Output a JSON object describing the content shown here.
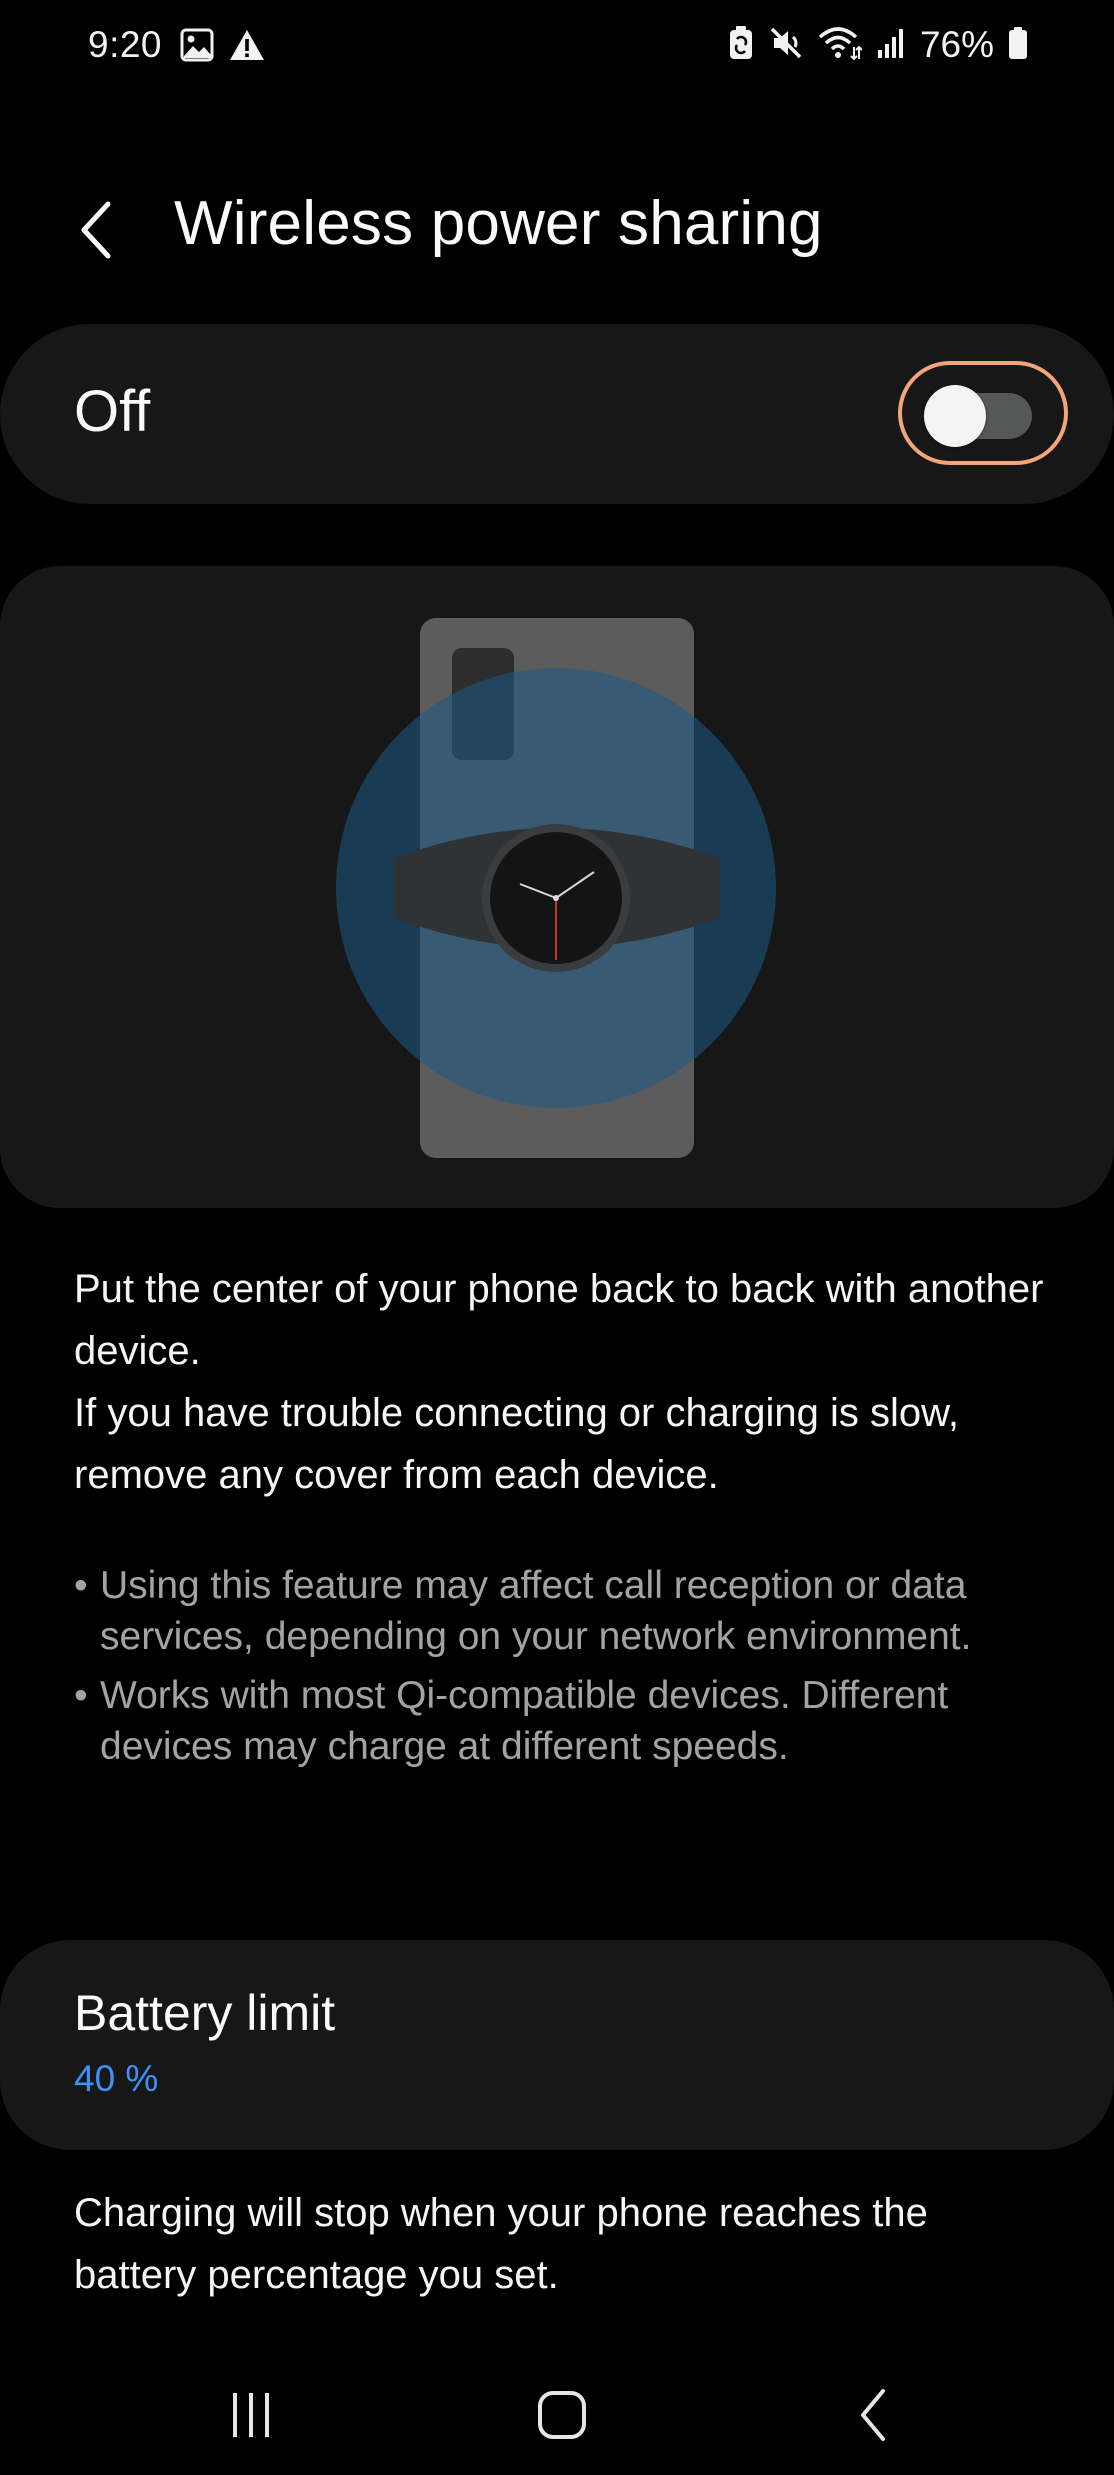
{
  "status_bar": {
    "time": "9:20",
    "left_icons": [
      "gallery-icon",
      "warning-icon"
    ],
    "right_icons": [
      "battery-share-icon",
      "mute-icon",
      "wifi-icon",
      "signal-icon",
      "battery-icon"
    ],
    "battery_percent": "76%"
  },
  "header": {
    "title": "Wireless power sharing"
  },
  "master_switch": {
    "label": "Off",
    "state": "off",
    "highlight_color": "#f2a57b"
  },
  "illustration": {
    "icon": "phone-and-watch-illustration"
  },
  "description": {
    "line1": "Put the center of your phone back to back with another device.",
    "line2": "If you have trouble connecting or charging is slow, remove any cover from each device."
  },
  "notes": [
    {
      "bullet": "•",
      "text": "Using this feature may affect call reception or data services, depending on your network environment."
    },
    {
      "bullet": "•",
      "text": "Works with most Qi-compatible devices. Different devices may charge at different speeds."
    }
  ],
  "battery_limit": {
    "title": "Battery limit",
    "value": "40 %",
    "value_color": "#3e91f7"
  },
  "battery_description": "Charging will stop when your phone reaches the battery percentage you set.",
  "nav_bar": {
    "items": [
      "recents-icon",
      "home-icon",
      "back-icon"
    ]
  }
}
